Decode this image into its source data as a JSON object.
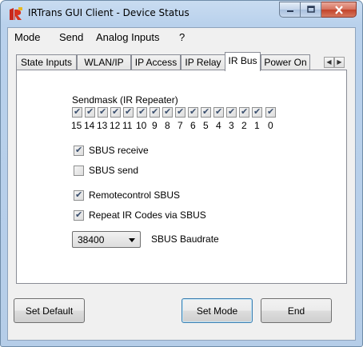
{
  "window": {
    "title": "IRTrans GUI Client - Device Status"
  },
  "menu": [
    "Mode",
    "Send",
    "Analog Inputs",
    "?"
  ],
  "tabs": [
    "State Inputs",
    "WLAN/IP",
    "IP Access",
    "IP Relay",
    "IR Bus",
    "Power On"
  ],
  "active_tab": "IR Bus",
  "sendmask": {
    "label": "Sendmask (IR Repeater)",
    "bits": [
      "15",
      "14",
      "13",
      "12",
      "11",
      "10",
      "9",
      "8",
      "7",
      "6",
      "5",
      "4",
      "3",
      "2",
      "1",
      "0"
    ],
    "checked": [
      true,
      true,
      true,
      true,
      true,
      true,
      true,
      true,
      true,
      true,
      true,
      true,
      true,
      true,
      true,
      true
    ]
  },
  "options": {
    "sbus_receive": {
      "label": "SBUS receive",
      "checked": true
    },
    "sbus_send": {
      "label": "SBUS send",
      "checked": false
    },
    "remotecontrol_sbus": {
      "label": "Remotecontrol SBUS",
      "checked": true
    },
    "repeat_ir": {
      "label": "Repeat IR Codes via SBUS",
      "checked": true
    }
  },
  "baudrate": {
    "value": "38400",
    "label": "SBUS Baudrate"
  },
  "buttons": {
    "set_default": "Set Default",
    "set_mode": "Set Mode",
    "end": "End"
  },
  "colors": {
    "titlebar": "#b9d1ec",
    "close": "#c2432a",
    "panel": "#ffffff",
    "client": "#f0f0f0"
  }
}
